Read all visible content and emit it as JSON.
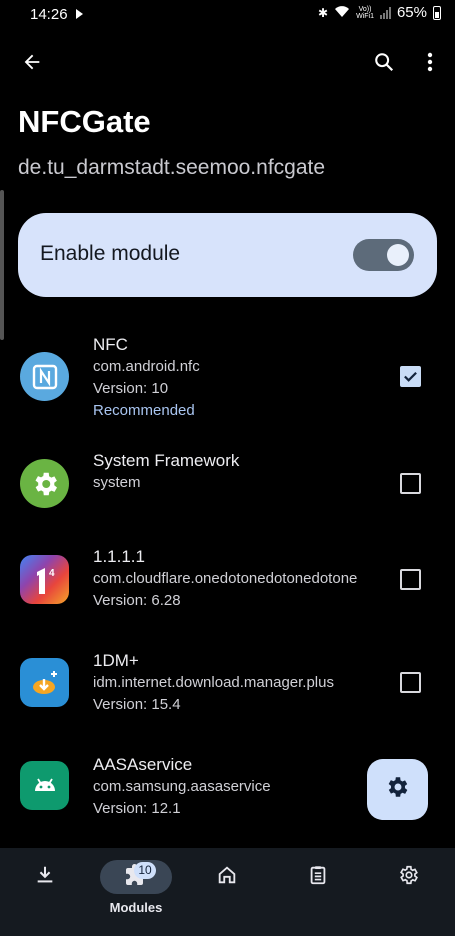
{
  "status_bar": {
    "time": "14:26",
    "wifi_label_top": "Vo))",
    "wifi_label_bottom": "WiFi1",
    "battery": "65%"
  },
  "toolbar": {
    "back_icon": "arrow-back-icon",
    "search_icon": "search-icon",
    "more_icon": "more-vert-icon"
  },
  "header": {
    "title": "NFCGate",
    "package": "de.tu_darmstadt.seemoo.nfcgate"
  },
  "enable_module": {
    "label": "Enable module",
    "enabled": true
  },
  "apps": [
    {
      "name": "NFC",
      "package": "com.android.nfc",
      "version": "Version: 10",
      "tag": "Recommended",
      "checked": true,
      "icon": "nfc-icon"
    },
    {
      "name": "System Framework",
      "package": "system",
      "version": "",
      "tag": "",
      "checked": false,
      "icon": "gear-icon"
    },
    {
      "name": "1.1.1.1",
      "package": "com.cloudflare.onedotonedotonedotone",
      "version": "Version: 6.28",
      "tag": "",
      "checked": false,
      "icon": "cloudflare-1111-icon"
    },
    {
      "name": "1DM+",
      "package": "idm.internet.download.manager.plus",
      "version": "Version: 15.4",
      "tag": "",
      "checked": false,
      "icon": "download-manager-icon"
    },
    {
      "name": "AASAservice",
      "package": "com.samsung.aasaservice",
      "version": "Version: 12.1",
      "tag": "",
      "checked": false,
      "icon": "android-icon"
    }
  ],
  "fab": {
    "icon": "settings-icon"
  },
  "bottom_nav": {
    "items": [
      {
        "icon": "download-icon",
        "label": ""
      },
      {
        "icon": "extension-icon",
        "label": "Modules",
        "badge": "10",
        "active": true
      },
      {
        "icon": "home-icon",
        "label": ""
      },
      {
        "icon": "clipboard-icon",
        "label": ""
      },
      {
        "icon": "settings-icon",
        "label": ""
      }
    ]
  },
  "colors": {
    "background": "#000000",
    "card": "#d7e3fb",
    "accent": "#a9c5f0",
    "nav_bar": "#151a20"
  }
}
